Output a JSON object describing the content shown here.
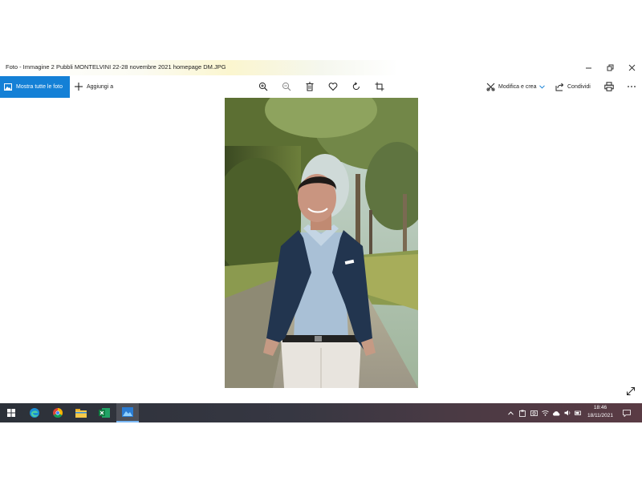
{
  "window": {
    "title": "Foto - Immagine 2 Pubbli MONTELVINI 22-28 novembre 2021 homepage DM.JPG",
    "controls": [
      "minimize",
      "restore",
      "close"
    ]
  },
  "toolbar": {
    "show_all_label": "Mostra tutte le foto",
    "add_label": "Aggiungi a",
    "center_tools": [
      "zoom-in-icon",
      "zoom-out-icon",
      "delete-icon",
      "favorite-icon",
      "rotate-icon",
      "crop-icon"
    ],
    "edit_label": "Modifica e crea",
    "share_label": "Condividi",
    "accent_color": "#1480d6"
  },
  "photo": {
    "subject": "man in navy blazer, light blue shirt and white trousers standing on a tree-lined path"
  },
  "taskbar": {
    "apps": [
      "windows-start-icon",
      "edge-icon",
      "chrome-icon",
      "file-explorer-icon",
      "excel-icon",
      "photos-icon"
    ],
    "active_app": "photos-icon",
    "time": "18:46",
    "date": "18/11/2021"
  }
}
